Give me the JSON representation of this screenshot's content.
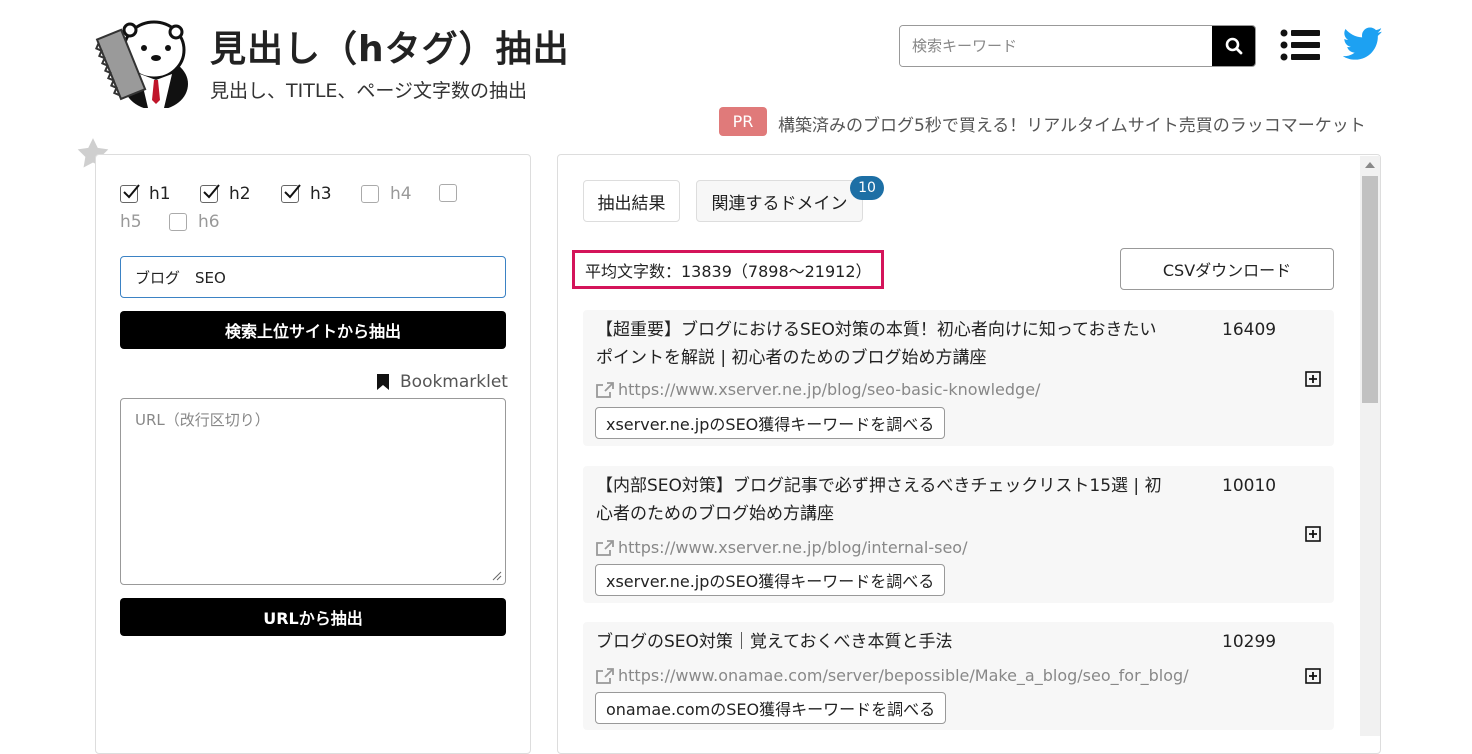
{
  "header": {
    "title": "見出し（hタグ）抽出",
    "subtitle": "見出し、TITLE、ページ文字数の抽出",
    "search_placeholder": "検索キーワード",
    "pr_badge": "PR",
    "pr_text": "構築済みのブログ5秒で買える！リアルタイムサイト売買のラッコマーケット"
  },
  "left": {
    "checkboxes": [
      {
        "label": "h1",
        "checked": true
      },
      {
        "label": "h2",
        "checked": true
      },
      {
        "label": "h3",
        "checked": true
      },
      {
        "label": "h4",
        "checked": false
      },
      {
        "label": "h5",
        "checked": false
      },
      {
        "label": "h6",
        "checked": false
      }
    ],
    "keyword_value": "ブログ　SEO",
    "extract_search_button": "検索上位サイトから抽出",
    "bookmarklet_label": "Bookmarklet",
    "url_placeholder": "URL（改行区切り）",
    "extract_url_button": "URLから抽出"
  },
  "right": {
    "tabs": [
      {
        "label": "抽出結果"
      },
      {
        "label": "関連するドメイン",
        "badge": "10"
      }
    ],
    "average": "平均文字数：13839（7898〜21912）",
    "csv_button": "CSVダウンロード",
    "results": [
      {
        "title": "【超重要】ブログにおけるSEO対策の本質！初心者向けに知っておきたいポイントを解説 | 初心者のためのブログ始め方講座",
        "count": "16409",
        "url": "https://www.xserver.ne.jp/blog/seo-basic-knowledge/",
        "keyword_button": "xserver.ne.jpのSEO獲得キーワードを調べる"
      },
      {
        "title": "【内部SEO対策】ブログ記事で必ず押さえるべきチェックリスト15選 | 初心者のためのブログ始め方講座",
        "count": "10010",
        "url": "https://www.xserver.ne.jp/blog/internal-seo/",
        "keyword_button": "xserver.ne.jpのSEO獲得キーワードを調べる"
      },
      {
        "title": "ブログのSEO対策｜覚えておくべき本質と手法",
        "count": "10299",
        "url": "https://www.onamae.com/server/bepossible/Make_a_blog/seo_for_blog/",
        "keyword_button": "onamae.comのSEO獲得キーワードを調べる"
      }
    ]
  },
  "colors": {
    "highlight_border": "#d4145a",
    "badge_blue": "#1d6fa5",
    "pr_badge_bg": "#e07a7a",
    "twitter_blue": "#1da1f2"
  },
  "icons": [
    "otter-logo",
    "search-icon",
    "menu-icon",
    "twitter-icon",
    "star-icon",
    "bookmark-icon",
    "external-link-icon",
    "expand-plus-icon",
    "checkmark-icon"
  ]
}
